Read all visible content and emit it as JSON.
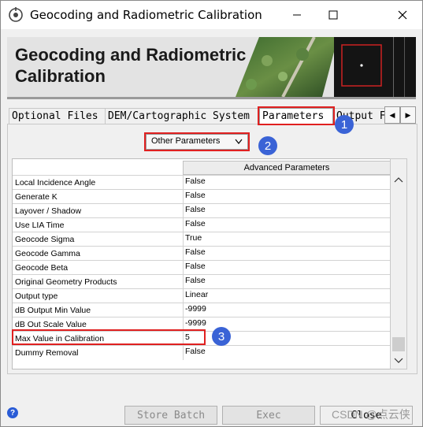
{
  "window": {
    "title": "Geocoding and Radiometric Calibration",
    "minimize_icon": "minimize-icon",
    "maximize_icon": "maximize-icon",
    "close_icon": "close-icon"
  },
  "banner": {
    "title_line1": "Geocoding and Radiometric",
    "title_line2": "Calibration"
  },
  "tabs": [
    {
      "label": "Optional Files",
      "active": false
    },
    {
      "label": "DEM/Cartographic System",
      "active": false
    },
    {
      "label": "Parameters",
      "active": true
    },
    {
      "label": "Output F",
      "active": false
    }
  ],
  "tab_nav": {
    "prev": "◀",
    "next": "▶"
  },
  "params_dropdown": {
    "selected": "Other Parameters"
  },
  "table": {
    "column_header": "Advanced Parameters",
    "rows": [
      {
        "name": "Local Incidence Angle",
        "value": "False"
      },
      {
        "name": "Generate K",
        "value": "False"
      },
      {
        "name": "Layover / Shadow",
        "value": "False"
      },
      {
        "name": "Use LIA Time",
        "value": "False"
      },
      {
        "name": "Geocode Sigma",
        "value": "True"
      },
      {
        "name": "Geocode Gamma",
        "value": "False"
      },
      {
        "name": "Geocode Beta",
        "value": "False"
      },
      {
        "name": "Original Geometry Products",
        "value": "False"
      },
      {
        "name": "Output type",
        "value": "Linear"
      },
      {
        "name": "dB Output Min Value",
        "value": "-9999"
      },
      {
        "name": "dB Out Scale Value",
        "value": "-9999"
      },
      {
        "name": "Max Value in Calibration",
        "value": "5"
      },
      {
        "name": "Dummy Removal",
        "value": "False"
      }
    ]
  },
  "annotations": {
    "badge1": "1",
    "badge2": "2",
    "badge3": "3",
    "color": "#3a63d6",
    "box_color": "#e02020"
  },
  "footer": {
    "help": "?",
    "store_batch": "Store Batch",
    "exec": "Exec",
    "close": "Close",
    "watermark": "CSDN @点云侠"
  }
}
